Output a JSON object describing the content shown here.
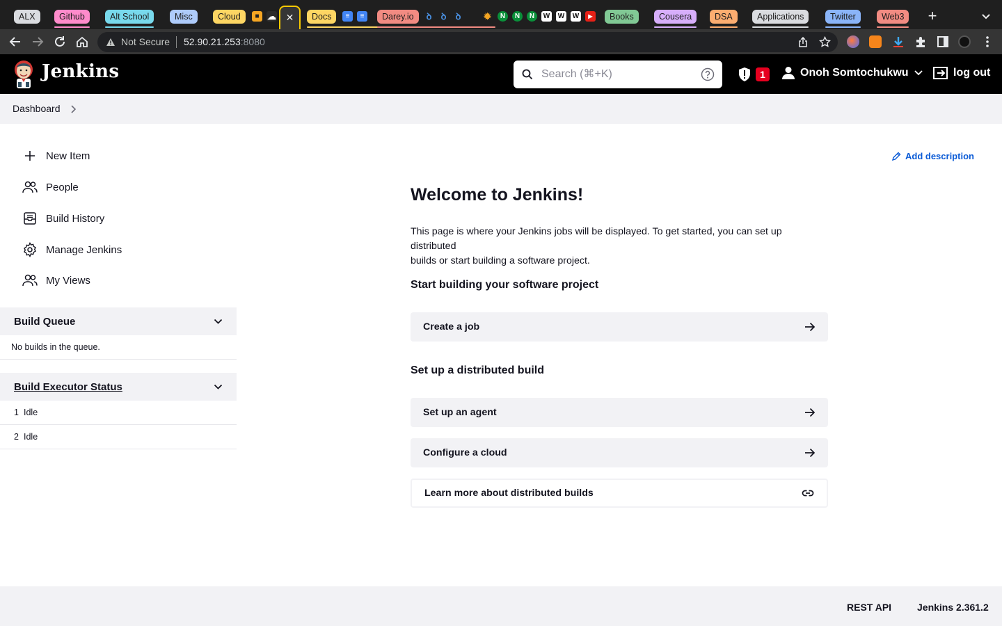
{
  "browser": {
    "tab_groups": [
      {
        "label": "ALX",
        "color": "#dadce0"
      },
      {
        "label": "Github",
        "color": "#ff8bcb"
      },
      {
        "label": "Alt School",
        "color": "#78d9ec"
      },
      {
        "label": "Misc",
        "color": "#aecbfa"
      },
      {
        "label": "Cloud",
        "color": "#fdd663"
      },
      {
        "label": "Docs",
        "color": "#fdd663"
      },
      {
        "label": "Darey.io",
        "color": "#f28b82"
      },
      {
        "label": "Books",
        "color": "#81c995"
      },
      {
        "label": "Cousera",
        "color": "#d7aefb"
      },
      {
        "label": "DSA",
        "color": "#fcad70"
      },
      {
        "label": "Applications",
        "color": "#dadce0"
      },
      {
        "label": "Twitter",
        "color": "#8ab4f8"
      },
      {
        "label": "Web3",
        "color": "#f28b82"
      }
    ],
    "active_tab_close": "✕",
    "new_tab": "+",
    "security_label": "Not Secure",
    "url_host": "52.90.21.253",
    "url_port": ":8080"
  },
  "header": {
    "brand": "Jenkins",
    "search_placeholder": "Search (⌘+K)",
    "alert_count": "1",
    "user_name": "Onoh Somtochukwu",
    "logout_label": "log out"
  },
  "breadcrumb": {
    "items": [
      "Dashboard"
    ]
  },
  "sidebar": {
    "tasks": [
      {
        "label": "New Item",
        "icon": "plus-icon"
      },
      {
        "label": "People",
        "icon": "people-icon"
      },
      {
        "label": "Build History",
        "icon": "inbox-icon"
      },
      {
        "label": "Manage Jenkins",
        "icon": "gear-icon"
      },
      {
        "label": "My Views",
        "icon": "people-icon"
      }
    ],
    "build_queue": {
      "title": "Build Queue",
      "empty_text": "No builds in the queue."
    },
    "executors": {
      "title": "Build Executor Status",
      "rows": [
        {
          "num": "1",
          "status": "Idle"
        },
        {
          "num": "2",
          "status": "Idle"
        }
      ]
    }
  },
  "main": {
    "add_description": "Add description",
    "title": "Welcome to Jenkins!",
    "intro_line1": "This page is where your Jenkins jobs will be displayed. To get started, you can set up distributed",
    "intro_line2": "builds or start building a software project.",
    "section1_title": "Start building your software project",
    "create_job": "Create a job",
    "section2_title": "Set up a distributed build",
    "setup_agent": "Set up an agent",
    "configure_cloud": "Configure a cloud",
    "learn_more": "Learn more about distributed builds"
  },
  "footer": {
    "rest_api": "REST API",
    "version": "Jenkins 2.361.2"
  }
}
